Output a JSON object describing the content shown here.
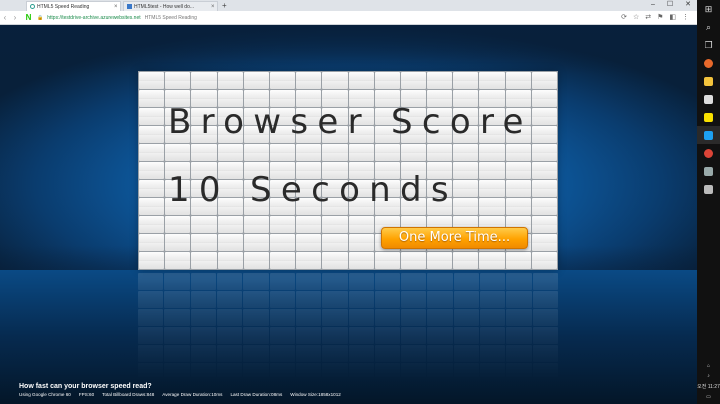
{
  "browser": {
    "tabs": [
      {
        "title": "HTML5 Speed Reading"
      },
      {
        "title": "HTML5test - How well do..."
      }
    ],
    "url_prefix": "https://",
    "url_host": "testdrive-archive.azurewebsites.net",
    "page_title": "HTML5 Speed Reading"
  },
  "board": {
    "line1": "Browser Score",
    "line2": "10 Seconds",
    "button_label": "One More Time..."
  },
  "footer": {
    "question": "How fast can your browser speed read?",
    "stats": [
      "Using Google Chrome 60",
      "FPS:60",
      "Total Billboard Draws:848",
      "Average Draw Duration:10ms",
      "Last Draw Duration:08ms",
      "Window Size:1858x1012"
    ]
  },
  "taskbar": {
    "clock": "오전 11:27",
    "icons": [
      "windows-icon",
      "search-icon",
      "task-view-icon",
      "firefox-icon",
      "explorer-icon",
      "mail-icon",
      "kakaotalk-icon",
      "twitter-icon",
      "chrome-icon",
      "app-icon",
      "app-icon"
    ]
  },
  "colors": {
    "accent_orange": "#ffa200",
    "page_blue": "#0e5fa8"
  }
}
